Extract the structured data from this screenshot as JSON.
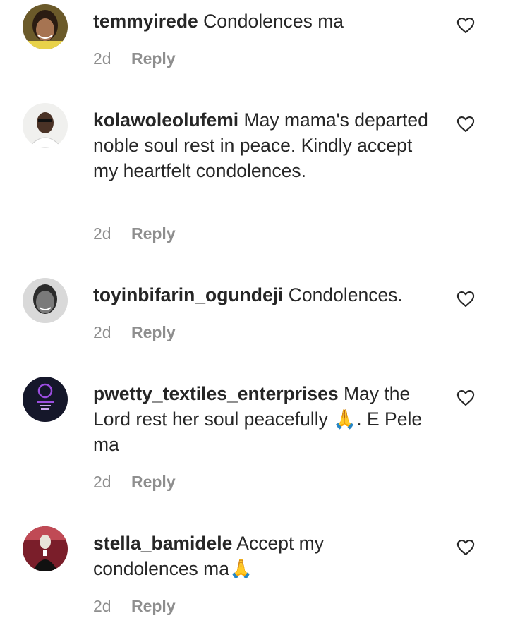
{
  "comments": [
    {
      "username": "temmyirede",
      "text": "Condolences ma",
      "time": "2d",
      "reply_label": "Reply",
      "avatar_icon": "avatar-photo",
      "like_icon": "heart-outline-icon"
    },
    {
      "username": "kolawoleolufemi",
      "text": "May mama's departed noble soul rest in peace. Kindly accept my heartfelt condolences.",
      "time": "2d",
      "reply_label": "Reply",
      "avatar_icon": "avatar-photo",
      "like_icon": "heart-outline-icon"
    },
    {
      "username": "toyinbifarin_ogundeji",
      "text": "Condolences.",
      "time": "2d",
      "reply_label": "Reply",
      "avatar_icon": "avatar-photo",
      "like_icon": "heart-outline-icon"
    },
    {
      "username": "pwetty_textiles_enterprises",
      "text": "May the Lord rest her soul peacefully 🙏. E Pele ma",
      "time": "2d",
      "reply_label": "Reply",
      "avatar_icon": "avatar-logo",
      "like_icon": "heart-outline-icon"
    },
    {
      "username": "stella_bamidele",
      "text": "Accept my condolences ma🙏",
      "time": "2d",
      "reply_label": "Reply",
      "avatar_icon": "avatar-photo",
      "like_icon": "heart-outline-icon"
    }
  ],
  "colors": {
    "text": "#262626",
    "secondary": "#8e8e8e",
    "background": "#ffffff"
  }
}
